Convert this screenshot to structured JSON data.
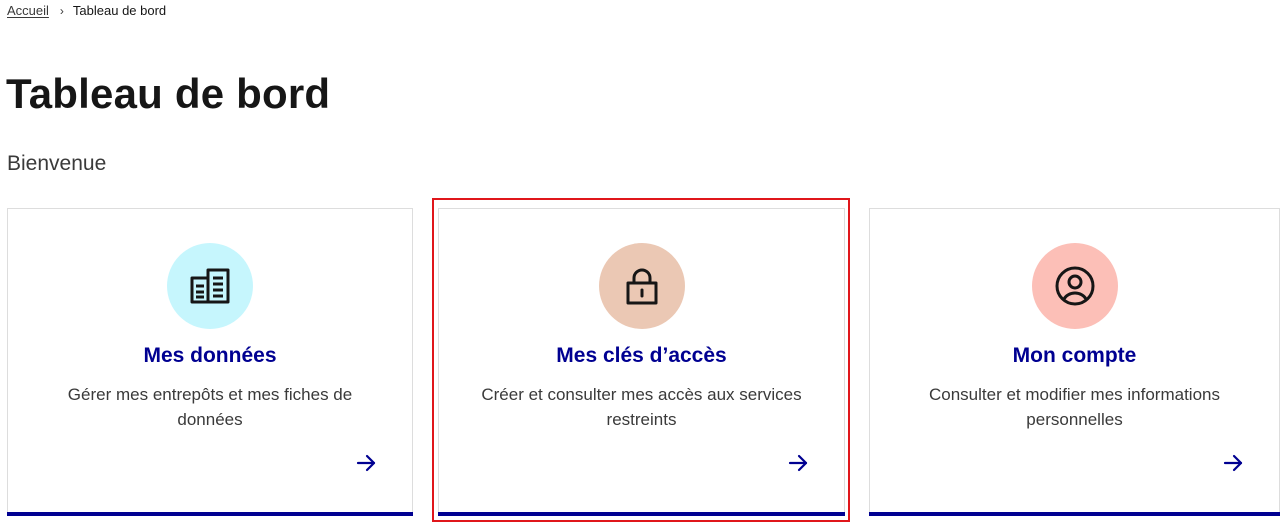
{
  "breadcrumb": {
    "home": "Accueil",
    "separator": "›",
    "current": "Tableau de bord"
  },
  "page": {
    "title": "Tableau de bord",
    "welcome": "Bienvenue"
  },
  "cards": [
    {
      "title": "Mes données",
      "description": "Gérer mes entrepôts et mes fiches de données",
      "icon": "building-data-icon",
      "icon_bg": "#c6f6fd"
    },
    {
      "title": "Mes clés d’accès",
      "description": "Créer et consulter mes accès aux services restreints",
      "icon": "lock-icon",
      "icon_bg": "#ebc8b4",
      "highlighted": true
    },
    {
      "title": "Mon compte",
      "description": "Consulter et modifier mes informations personnelles",
      "icon": "user-circle-icon",
      "icon_bg": "#fcbfb7"
    }
  ],
  "colors": {
    "accent": "#000091",
    "highlight_border": "#e0161b",
    "text": "#161616"
  }
}
